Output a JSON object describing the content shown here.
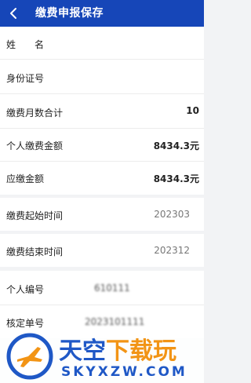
{
  "header": {
    "title": "缴费申报保存",
    "accent": "#1646b8"
  },
  "rows": [
    {
      "label": "姓　　名",
      "value": ""
    },
    {
      "label": "身份证号",
      "value": ""
    },
    {
      "label": "缴费月数合计",
      "value": "10"
    },
    {
      "label": "个人缴费金额",
      "value": "8434.3元"
    },
    {
      "label": "应缴金额",
      "value": "8434.3元"
    },
    {
      "label": "缴费起始时间",
      "value": "202303"
    },
    {
      "label": "缴费结束时间",
      "value": "202312"
    },
    {
      "label": "个人编号",
      "value": "610111"
    },
    {
      "label": "核定单号",
      "value": "2023101111"
    }
  ],
  "watermark": {
    "cn_blue": "天空",
    "cn_orange": "下载玩",
    "en": "SKYXZW.COM",
    "icons": [
      "airplane-icon"
    ]
  }
}
